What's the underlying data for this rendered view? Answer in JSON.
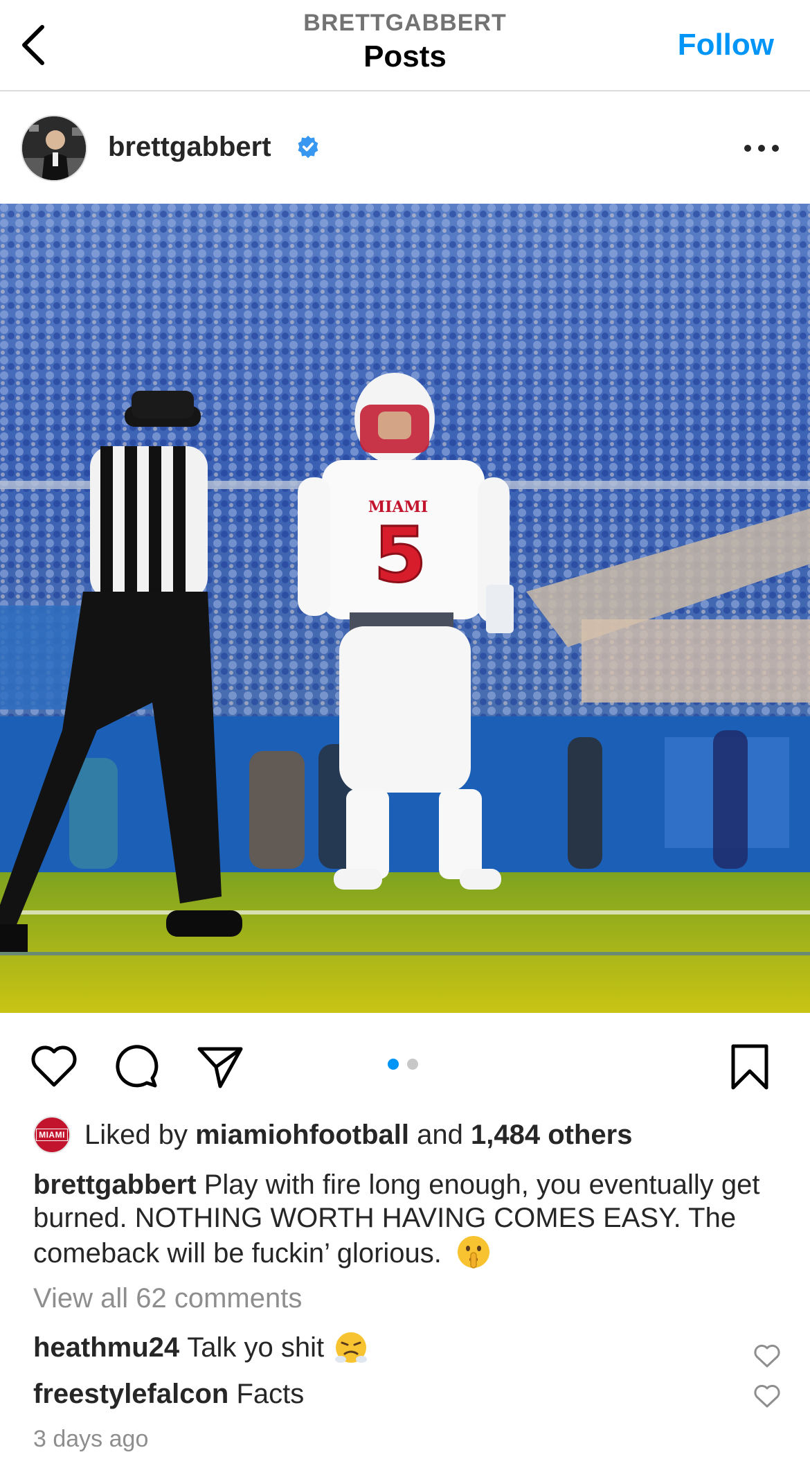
{
  "header": {
    "username": "BRETTGABBERT",
    "title": "Posts",
    "follow_label": "Follow",
    "back_icon": "chevron-left-icon"
  },
  "post": {
    "author": "brettgabbert",
    "verified": true,
    "more_icon": "more-horizontal-icon",
    "carousel": {
      "current": 1,
      "total": 2
    },
    "likes": {
      "prefix": "Liked by",
      "liked_by": "miamiohfootball",
      "conjunction": "and",
      "others": "1,484 others",
      "badge_text": "MIAMI"
    },
    "caption": {
      "user": "brettgabbert",
      "text": "Play with fire long enough, you eventually get burned. NOTHING WORTH HAVING COMES EASY. The comeback will be fuckin’ glorious."
    },
    "view_all_comments": "View all 62 comments",
    "comments": [
      {
        "user": "heathmu24",
        "text": "Talk yo shit"
      },
      {
        "user": "freestylefalcon",
        "text": "Facts"
      }
    ],
    "timestamp": "3 days ago"
  },
  "colors": {
    "accent": "#0095f6",
    "text": "#262626",
    "muted": "#8e8e8e",
    "miami_red": "#c3142d"
  }
}
